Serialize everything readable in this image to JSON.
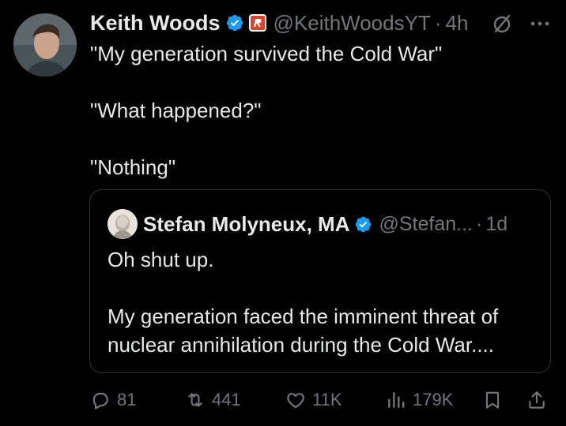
{
  "post": {
    "author_name": "Keith Woods",
    "handle": "@KeithWoodsYT",
    "separator": "·",
    "time": "4h",
    "paragraphs": [
      "\"My generation survived the Cold War\"",
      "\"What happened?\"",
      "\"Nothing\""
    ]
  },
  "quote": {
    "author_name": "Stefan Molyneux, MA",
    "handle": "@Stefan...",
    "separator": "·",
    "time": "1d",
    "paragraphs": [
      "Oh shut up.",
      "My generation faced the imminent threat of nuclear annihilation during the Cold War...."
    ]
  },
  "actions": {
    "replies": "81",
    "reposts": "441",
    "likes": "11K",
    "views": "179K"
  },
  "icons": {
    "verified": "verified-badge-icon",
    "affiliate": "affiliate-badge-icon",
    "grok": "grok-icon",
    "more": "more-icon",
    "reply": "reply-icon",
    "repost": "repost-icon",
    "like": "heart-icon",
    "views": "views-chart-icon",
    "bookmark": "bookmark-icon",
    "share": "share-icon"
  },
  "colors": {
    "background": "#000000",
    "text": "#e7e9ea",
    "muted": "#71767b",
    "verified": "#1d9bf0",
    "affiliate": "#e0412e",
    "border": "#2f3336"
  }
}
